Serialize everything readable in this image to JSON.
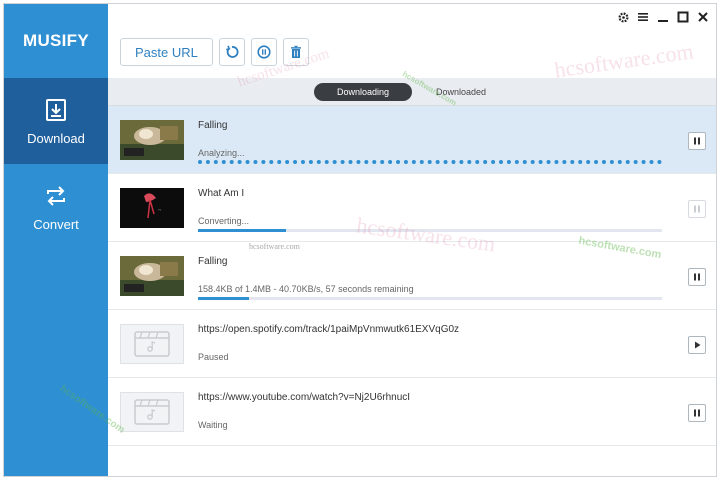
{
  "app": {
    "name": "MUSIFY"
  },
  "sidebar": {
    "items": [
      {
        "label": "Download",
        "icon": "download-icon",
        "active": true
      },
      {
        "label": "Convert",
        "icon": "convert-icon",
        "active": false
      }
    ]
  },
  "titlebar": {
    "icons": [
      "gear-icon",
      "menu-icon",
      "minimize-icon",
      "maximize-icon",
      "close-icon"
    ]
  },
  "toolbar": {
    "paste_label": "Paste URL",
    "icons": [
      "refresh-icon",
      "pause-all-icon",
      "trash-icon"
    ]
  },
  "tabs": [
    {
      "label": "Downloading",
      "active": true
    },
    {
      "label": "Downloaded",
      "active": false
    }
  ],
  "downloads": [
    {
      "title": "Falling",
      "status": "Analyzing...",
      "progress": null,
      "indeterminate": true,
      "action": "pause",
      "selected": true,
      "thumb": "photo"
    },
    {
      "title": "What Am I",
      "status": "Converting...",
      "progress": 0.19,
      "indeterminate": false,
      "action": "pause",
      "selected": false,
      "thumb": "dark",
      "action_disabled": true
    },
    {
      "title": "Falling",
      "status": "158.4KB of 1.4MB - 40.70KB/s, 57 seconds remaining",
      "progress": 0.11,
      "indeterminate": false,
      "action": "pause",
      "selected": false,
      "thumb": "photo"
    },
    {
      "title": "https://open.spotify.com/track/1paiMpVnmwutk61EXVqG0z",
      "status": "Paused",
      "progress": null,
      "indeterminate": false,
      "action": "play",
      "selected": false,
      "thumb": "placeholder"
    },
    {
      "title": "https://www.youtube.com/watch?v=Nj2U6rhnucI",
      "status": "Waiting",
      "progress": null,
      "indeterminate": false,
      "action": "pause",
      "selected": false,
      "thumb": "placeholder"
    }
  ],
  "colors": {
    "sidebar": "#2f8fd3",
    "sidebar_active": "#1f5f9c",
    "accent": "#2f8fd3",
    "selected_row": "#dbe9f6"
  },
  "watermark": "hcsoftware.com"
}
